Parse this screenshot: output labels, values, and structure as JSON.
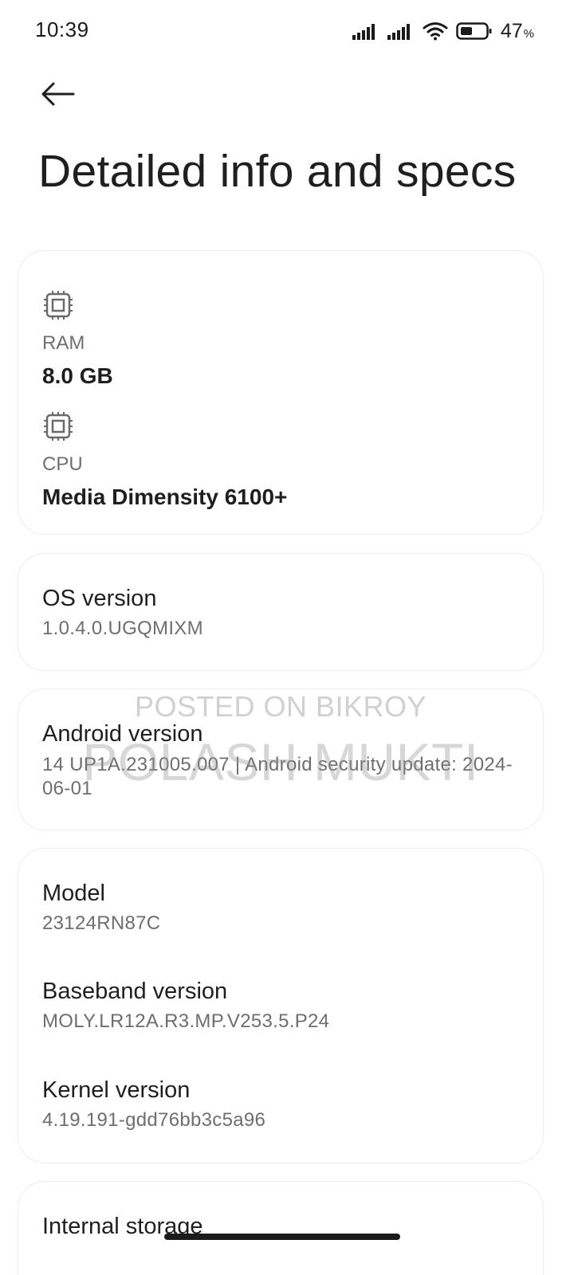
{
  "status_bar": {
    "time": "10:39",
    "battery_percent": "47",
    "battery_percent_sign": "%",
    "icons": [
      "signal-icon",
      "signal-icon",
      "wifi-icon",
      "battery-icon"
    ]
  },
  "header": {
    "back_icon": "arrow-left-icon",
    "title": "Detailed info and specs"
  },
  "hardware": {
    "ram": {
      "icon": "chip-icon",
      "label": "RAM",
      "value": "8.0 GB"
    },
    "cpu": {
      "icon": "chip-icon",
      "label": "CPU",
      "value": "Media Dimensity 6100+"
    }
  },
  "os": {
    "title": "OS version",
    "value": "1.0.4.0.UGQMIXM"
  },
  "android": {
    "title": "Android version",
    "value": "14 UP1A.231005.007 | Android security update: 2024-06-01"
  },
  "device": {
    "model": {
      "title": "Model",
      "value": "23124RN87C"
    },
    "baseband": {
      "title": "Baseband version",
      "value": "MOLY.LR12A.R3.MP.V253.5.P24"
    },
    "kernel": {
      "title": "Kernel version",
      "value": "4.19.191-gdd76bb3c5a96"
    }
  },
  "storage": {
    "title": "Internal storage"
  },
  "watermark": {
    "line1": "POSTED ON BIKROY",
    "line2": "POLASH MUKTI"
  },
  "colors": {
    "background": "#ffffff",
    "card_border": "#ececec",
    "primary_text": "#1f1f1f",
    "secondary_text": "#6e6e6e"
  }
}
